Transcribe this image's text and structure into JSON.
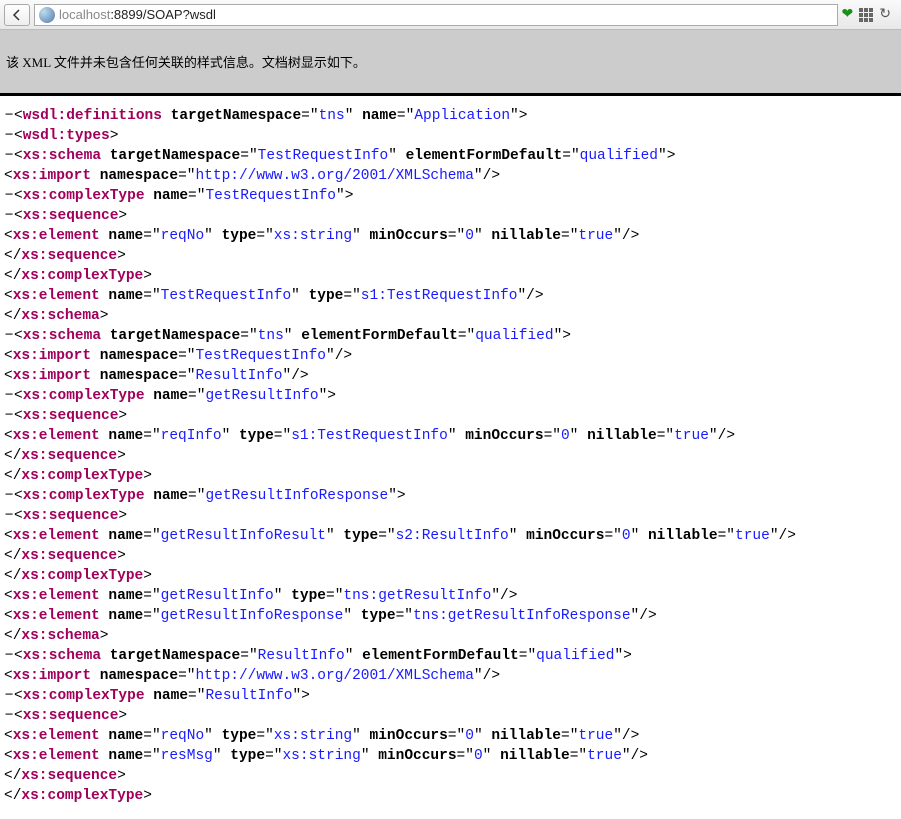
{
  "url": {
    "prefix": "localhost",
    "port": ":8899",
    "path": "/SOAP?wsdl"
  },
  "banner": "该 XML 文件并未包含任何关联的样式信息。文档树显示如下。",
  "xml": {
    "root": {
      "tag": "wsdl:definitions",
      "attrs": [
        [
          "targetNamespace",
          "tns"
        ],
        [
          "name",
          "Application"
        ]
      ]
    },
    "types": {
      "tag": "wsdl:types"
    },
    "schema1": {
      "tag": "xs:schema",
      "attrs": [
        [
          "targetNamespace",
          "TestRequestInfo"
        ],
        [
          "elementFormDefault",
          "qualified"
        ]
      ],
      "import": {
        "tag": "xs:import",
        "attrs": [
          [
            "namespace",
            "http://www.w3.org/2001/XMLSchema"
          ]
        ]
      },
      "ct": {
        "tag": "xs:complexType",
        "attrs": [
          [
            "name",
            "TestRequestInfo"
          ]
        ]
      },
      "seq": {
        "tag": "xs:sequence"
      },
      "el": {
        "tag": "xs:element",
        "attrs": [
          [
            "name",
            "reqNo"
          ],
          [
            "type",
            "xs:string"
          ],
          [
            "minOccurs",
            "0"
          ],
          [
            "nillable",
            "true"
          ]
        ]
      },
      "elout": {
        "tag": "xs:element",
        "attrs": [
          [
            "name",
            "TestRequestInfo"
          ],
          [
            "type",
            "s1:TestRequestInfo"
          ]
        ]
      }
    },
    "schema2": {
      "tag": "xs:schema",
      "attrs": [
        [
          "targetNamespace",
          "tns"
        ],
        [
          "elementFormDefault",
          "qualified"
        ]
      ],
      "import1": {
        "tag": "xs:import",
        "attrs": [
          [
            "namespace",
            "TestRequestInfo"
          ]
        ]
      },
      "import2": {
        "tag": "xs:import",
        "attrs": [
          [
            "namespace",
            "ResultInfo"
          ]
        ]
      },
      "ct1": {
        "tag": "xs:complexType",
        "attrs": [
          [
            "name",
            "getResultInfo"
          ]
        ]
      },
      "seq": {
        "tag": "xs:sequence"
      },
      "el1": {
        "tag": "xs:element",
        "attrs": [
          [
            "name",
            "reqInfo"
          ],
          [
            "type",
            "s1:TestRequestInfo"
          ],
          [
            "minOccurs",
            "0"
          ],
          [
            "nillable",
            "true"
          ]
        ]
      },
      "ct2": {
        "tag": "xs:complexType",
        "attrs": [
          [
            "name",
            "getResultInfoResponse"
          ]
        ]
      },
      "el2": {
        "tag": "xs:element",
        "attrs": [
          [
            "name",
            "getResultInfoResult"
          ],
          [
            "type",
            "s2:ResultInfo"
          ],
          [
            "minOccurs",
            "0"
          ],
          [
            "nillable",
            "true"
          ]
        ]
      },
      "elout1": {
        "tag": "xs:element",
        "attrs": [
          [
            "name",
            "getResultInfo"
          ],
          [
            "type",
            "tns:getResultInfo"
          ]
        ]
      },
      "elout2": {
        "tag": "xs:element",
        "attrs": [
          [
            "name",
            "getResultInfoResponse"
          ],
          [
            "type",
            "tns:getResultInfoResponse"
          ]
        ]
      }
    },
    "schema3": {
      "tag": "xs:schema",
      "attrs": [
        [
          "targetNamespace",
          "ResultInfo"
        ],
        [
          "elementFormDefault",
          "qualified"
        ]
      ],
      "import": {
        "tag": "xs:import",
        "attrs": [
          [
            "namespace",
            "http://www.w3.org/2001/XMLSchema"
          ]
        ]
      },
      "ct": {
        "tag": "xs:complexType",
        "attrs": [
          [
            "name",
            "ResultInfo"
          ]
        ]
      },
      "seq": {
        "tag": "xs:sequence"
      },
      "el1": {
        "tag": "xs:element",
        "attrs": [
          [
            "name",
            "reqNo"
          ],
          [
            "type",
            "xs:string"
          ],
          [
            "minOccurs",
            "0"
          ],
          [
            "nillable",
            "true"
          ]
        ]
      },
      "el2": {
        "tag": "xs:element",
        "attrs": [
          [
            "name",
            "resMsg"
          ],
          [
            "type",
            "xs:string"
          ],
          [
            "minOccurs",
            "0"
          ],
          [
            "nillable",
            "true"
          ]
        ]
      }
    }
  }
}
